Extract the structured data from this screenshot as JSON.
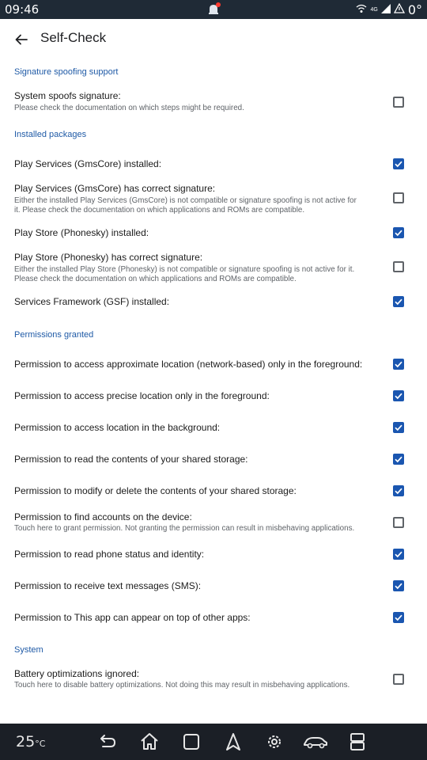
{
  "status_bar": {
    "time": "09:46",
    "network": "4G",
    "temperature": "0°"
  },
  "app_bar": {
    "title": "Self-Check"
  },
  "sections": {
    "signature": "Signature spoofing support",
    "packages": "Installed packages",
    "permissions": "Permissions granted",
    "system": "System"
  },
  "checks": {
    "spoof": {
      "label": "System spoofs signature:",
      "sub": "Please check the documentation on which steps might be required.",
      "checked": false
    },
    "gms_installed": {
      "label": "Play Services (GmsCore) installed:",
      "checked": true
    },
    "gms_signature": {
      "label": "Play Services (GmsCore) has correct signature:",
      "sub1": "Either the installed Play Services (GmsCore) is not compatible or signature spoofing is not active for",
      "sub2": "it. Please check the documentation on which applications and ROMs are compatible.",
      "checked": false
    },
    "store_installed": {
      "label": "Play Store (Phonesky) installed:",
      "checked": true
    },
    "store_signature": {
      "label": "Play Store (Phonesky) has correct signature:",
      "sub1": "Either the installed Play Store (Phonesky) is not compatible or signature spoofing is not active for it.",
      "sub2": "Please check the documentation on which applications and ROMs are compatible.",
      "checked": false
    },
    "gsf_installed": {
      "label": "Services Framework (GSF) installed:",
      "checked": true
    },
    "perm_coarse": {
      "label": "Permission to access approximate location (network-based) only in the foreground:",
      "checked": true
    },
    "perm_fine": {
      "label": "Permission to access precise location only in the foreground:",
      "checked": true
    },
    "perm_background": {
      "label": "Permission to access location in the background:",
      "checked": true
    },
    "perm_read_storage": {
      "label": "Permission to read the contents of your shared storage:",
      "checked": true
    },
    "perm_write_storage": {
      "label": "Permission to modify or delete the contents of your shared storage:",
      "checked": true
    },
    "perm_accounts": {
      "label": "Permission to find accounts on the device:",
      "sub": "Touch here to grant permission. Not granting the permission can result in misbehaving applications.",
      "checked": false
    },
    "perm_phone": {
      "label": "Permission to read phone status and identity:",
      "checked": true
    },
    "perm_sms": {
      "label": "Permission to receive text messages (SMS):",
      "checked": true
    },
    "perm_overlay": {
      "label": "Permission to This app can appear on top of other apps:",
      "checked": true
    },
    "battery": {
      "label": "Battery optimizations ignored:",
      "sub": "Touch here to disable battery optimizations. Not doing this may result in misbehaving applications.",
      "checked": false
    }
  },
  "nav_bar": {
    "temperature": "25",
    "unit": "°C"
  },
  "colors": {
    "accent": "#1a56b0",
    "status_bar": "#1f2a36",
    "nav_bar": "#1b1f26"
  }
}
